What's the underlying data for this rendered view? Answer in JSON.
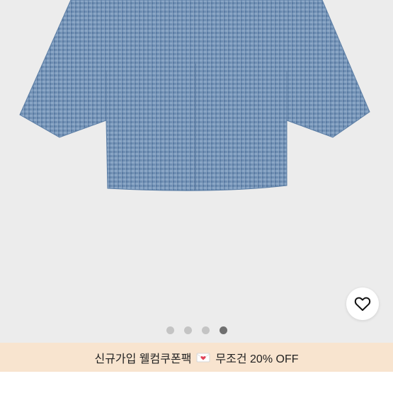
{
  "carousel": {
    "image_alt": "blue tweed cropped short-sleeve top",
    "slide_count": 4,
    "active_index": 3
  },
  "wishlist": {
    "icon": "heart-outline-icon"
  },
  "promo": {
    "text_before": "신규가입 웰컴쿠폰팩",
    "icon": "envelope-heart-icon",
    "text_after": "무조건 20% OFF",
    "background": "#f8e4cf"
  },
  "colors": {
    "image_background": "#ececec",
    "fabric": "#6f8fb3",
    "dot_active": "#6f6f6f",
    "dot_inactive": "#c4c4c4"
  }
}
